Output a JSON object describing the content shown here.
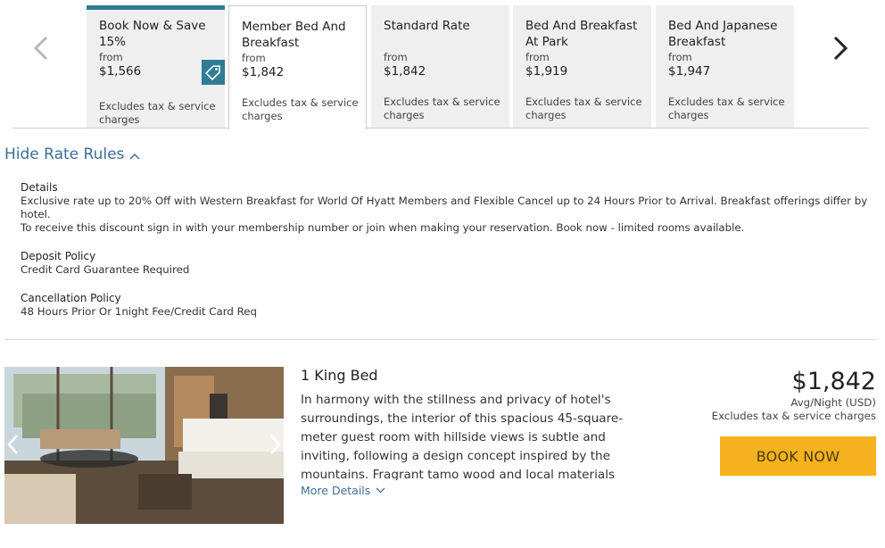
{
  "rates": [
    {
      "name": "Book Now & Save 15%",
      "from": "from",
      "price": "$1,566",
      "note": "Excludes tax & service charges"
    },
    {
      "name": "Member Bed And Breakfast",
      "from": "from",
      "price": "$1,842",
      "note": "Excludes tax & service charges"
    },
    {
      "name": "Standard Rate",
      "from": "from",
      "price": "$1,842",
      "note": "Excludes tax & service charges"
    },
    {
      "name": "Bed And Breakfast At Park",
      "from": "from",
      "price": "$1,919",
      "note": "Excludes tax & service charges"
    },
    {
      "name": "Bed And Japanese Breakfast",
      "from": "from",
      "price": "$1,947",
      "note": "Excludes tax & service charges"
    }
  ],
  "rate_rules": {
    "toggle_label": "Hide Rate Rules",
    "details_heading": "Details",
    "details_text_1": "Exclusive rate up to 20% Off with Western Breakfast for World Of Hyatt Members and Flexible Cancel up to 24 Hours Prior to Arrival. Breakfast offerings differ by hotel.",
    "details_text_2": "To receive this discount sign in with your membership number or join when making your reservation. Book now - limited rooms available.",
    "deposit_heading": "Deposit Policy",
    "deposit_text": "Credit Card Guarantee Required",
    "cancellation_heading": "Cancellation Policy",
    "cancellation_text": "48 Hours Prior Or 1night Fee/Credit Card Req"
  },
  "room": {
    "title": "1 King Bed",
    "description": "In harmony with the stillness and privacy of hotel's surroundings, the interior of this spacious 45-square-meter guest room with hillside views is subtle and inviting, following a design concept inspired by the mountains. Fragrant tamo wood and local materials anchor time-old",
    "more_details": "More Details",
    "price": "$1,842",
    "per_night": "Avg/Night (USD)",
    "excludes": "Excludes tax & service charges",
    "book_label": "BOOK NOW"
  },
  "colors": {
    "accent": "#2f7c94",
    "link": "#3c6e97",
    "book_button": "#f5b21c",
    "card_bg": "#efefef"
  },
  "icons": {
    "carousel_prev": "chevron-left-icon",
    "carousel_next": "chevron-right-icon",
    "tag": "tag-icon",
    "toggle": "chevron-up-icon",
    "more": "chevron-down-icon"
  }
}
